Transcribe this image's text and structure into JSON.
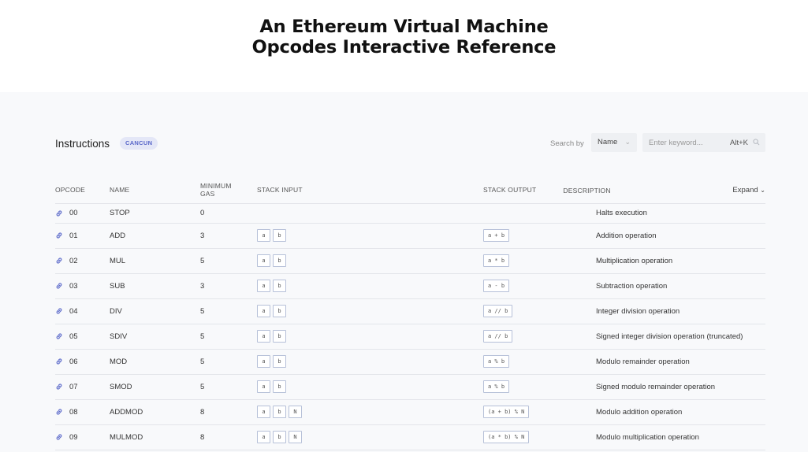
{
  "page": {
    "title_line1": "An Ethereum Virtual Machine",
    "title_line2": "Opcodes Interactive Reference"
  },
  "toolbar": {
    "title": "Instructions",
    "badge": "CANCUN",
    "search_label": "Search by",
    "search_by_value": "Name",
    "keyword_placeholder": "Enter keyword...",
    "shortcut": "Alt+K"
  },
  "table": {
    "headers": {
      "opcode": "OPCODE",
      "name": "NAME",
      "gas_line1": "MINIMUM",
      "gas_line2": "GAS",
      "stack_input": "STACK INPUT",
      "stack_output": "STACK OUTPUT",
      "description": "DESCRIPTION",
      "expand": "Expand"
    },
    "rows": [
      {
        "opcode": "00",
        "name": "STOP",
        "gas": "0",
        "inputs": [],
        "output": "",
        "description": "Halts execution"
      },
      {
        "opcode": "01",
        "name": "ADD",
        "gas": "3",
        "inputs": [
          "a",
          "b"
        ],
        "output": "a + b",
        "description": "Addition operation"
      },
      {
        "opcode": "02",
        "name": "MUL",
        "gas": "5",
        "inputs": [
          "a",
          "b"
        ],
        "output": "a * b",
        "description": "Multiplication operation"
      },
      {
        "opcode": "03",
        "name": "SUB",
        "gas": "3",
        "inputs": [
          "a",
          "b"
        ],
        "output": "a - b",
        "description": "Subtraction operation"
      },
      {
        "opcode": "04",
        "name": "DIV",
        "gas": "5",
        "inputs": [
          "a",
          "b"
        ],
        "output": "a // b",
        "description": "Integer division operation"
      },
      {
        "opcode": "05",
        "name": "SDIV",
        "gas": "5",
        "inputs": [
          "a",
          "b"
        ],
        "output": "a // b",
        "description": "Signed integer division operation (truncated)"
      },
      {
        "opcode": "06",
        "name": "MOD",
        "gas": "5",
        "inputs": [
          "a",
          "b"
        ],
        "output": "a % b",
        "description": "Modulo remainder operation"
      },
      {
        "opcode": "07",
        "name": "SMOD",
        "gas": "5",
        "inputs": [
          "a",
          "b"
        ],
        "output": "a % b",
        "description": "Signed modulo remainder operation"
      },
      {
        "opcode": "08",
        "name": "ADDMOD",
        "gas": "8",
        "inputs": [
          "a",
          "b",
          "N"
        ],
        "output": "(a + b) % N",
        "description": "Modulo addition operation"
      },
      {
        "opcode": "09",
        "name": "MULMOD",
        "gas": "8",
        "inputs": [
          "a",
          "b",
          "N"
        ],
        "output": "(a * b) % N",
        "description": "Modulo multiplication operation"
      }
    ]
  },
  "colors": {
    "accent": "#5a68c9",
    "badge_bg": "#e4e7f7",
    "chip_border": "#b6c0d8",
    "page_bg": "#f8f9fb"
  },
  "icons": {
    "row_link": "link-icon",
    "search": "search-icon",
    "dropdown": "chevron-down-icon"
  }
}
